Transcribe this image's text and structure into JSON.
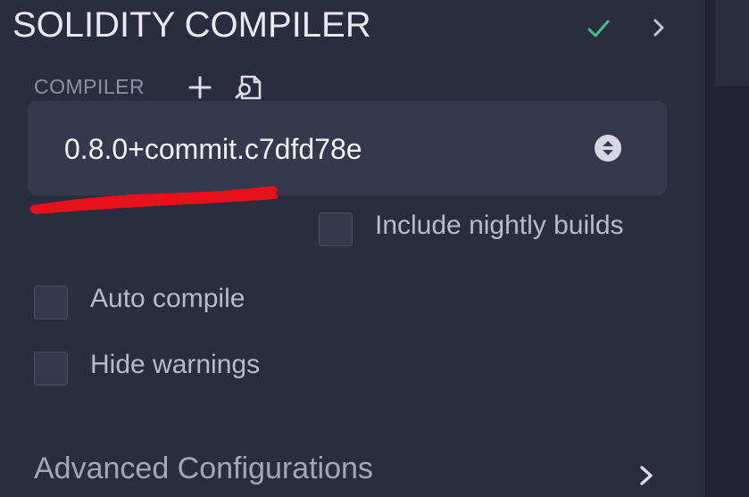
{
  "header": {
    "title": "SOLIDITY COMPILER",
    "status_icon": "checkmark-icon",
    "status_color": "#3fbf8a",
    "collapse_icon": "chevron-right-icon"
  },
  "compiler": {
    "label": "COMPILER",
    "add_icon": "plus-icon",
    "load_icon": "file-search-icon",
    "selected_version": "0.8.0+commit.c7dfd78e",
    "select_icon": "up-down-arrows-icon"
  },
  "options": {
    "nightly_label": "Include nightly builds",
    "nightly_checked": false,
    "auto_compile_label": "Auto compile",
    "auto_compile_checked": false,
    "hide_warnings_label": "Hide warnings",
    "hide_warnings_checked": false
  },
  "advanced": {
    "label": "Advanced Configurations",
    "icon": "chevron-right-icon"
  },
  "colors": {
    "panel_bg": "#2a2c3f",
    "select_bg": "#36384d",
    "annotation": "#e8101b"
  }
}
